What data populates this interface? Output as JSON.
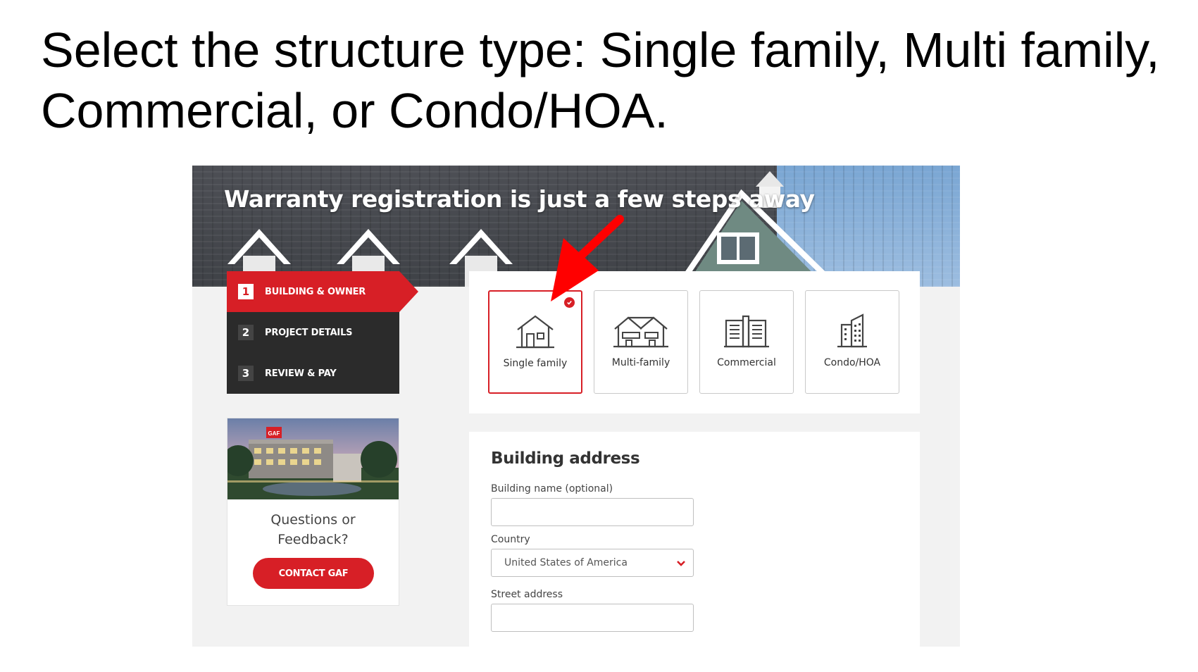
{
  "slide": {
    "instruction": "Select the structure type: Single family, Multi family, Commercial, or Condo/HOA."
  },
  "hero": {
    "title": "Warranty registration is just a few steps away"
  },
  "steps": [
    {
      "number": "1",
      "label": "BUILDING & OWNER",
      "active": true
    },
    {
      "number": "2",
      "label": "PROJECT DETAILS",
      "active": false
    },
    {
      "number": "3",
      "label": "REVIEW & PAY",
      "active": false
    }
  ],
  "contact": {
    "question_line1": "Questions or",
    "question_line2": "Feedback?",
    "button_label": "CONTACT GAF",
    "photo_sign": "GAF"
  },
  "structure_types": [
    {
      "label": "Single family",
      "icon": "single-family-house-icon",
      "selected": true
    },
    {
      "label": "Multi-family",
      "icon": "multi-family-house-icon",
      "selected": false
    },
    {
      "label": "Commercial",
      "icon": "commercial-building-icon",
      "selected": false
    },
    {
      "label": "Condo/HOA",
      "icon": "condo-building-icon",
      "selected": false
    }
  ],
  "address": {
    "heading": "Building address",
    "building_name_label": "Building name (optional)",
    "building_name_value": "",
    "country_label": "Country",
    "country_value": "United States of America",
    "street_label": "Street address",
    "street_value": ""
  },
  "colors": {
    "accent": "#d71f26",
    "nav_dark": "#2b2b2b",
    "panel_bg": "#f2f2f2",
    "annotation_arrow": "#ff0000"
  }
}
